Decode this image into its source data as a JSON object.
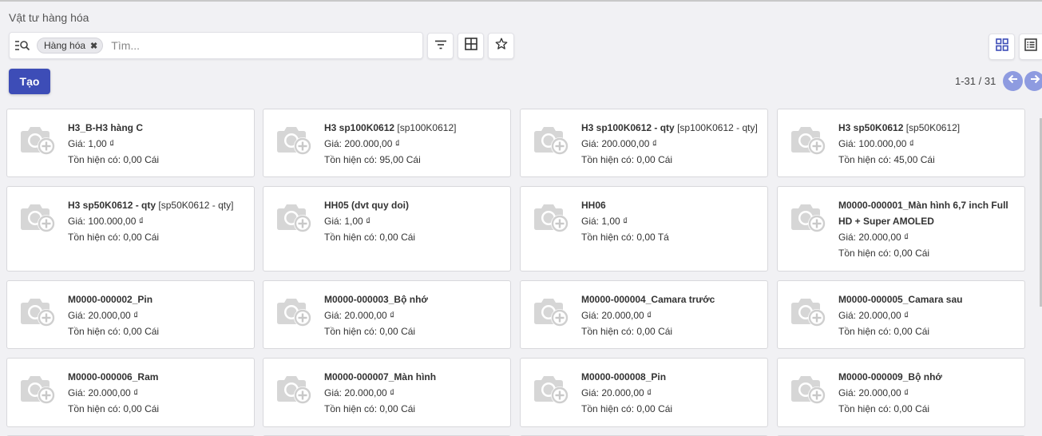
{
  "breadcrumb": "Vật tư hàng hóa",
  "search": {
    "facet_label": "Hàng hóa",
    "placeholder": "Tìm..."
  },
  "toolbar": {
    "create_label": "Tạo"
  },
  "pager": {
    "text": "1-31 / 31"
  },
  "icons": {
    "search": "search-list-icon",
    "filter": "filter-icon",
    "groupby": "grid-icon",
    "favorite": "star-icon",
    "kanban_view": "kanban-view-icon",
    "list_view": "list-view-icon",
    "prev": "arrow-left-icon",
    "next": "arrow-right-icon",
    "product_image": "camera-add-icon"
  },
  "colors": {
    "primary": "#3d4db7",
    "pager": "#8e9be0"
  },
  "products": [
    {
      "name": "H3_B-H3 hàng C",
      "code": "",
      "price": "Giá: 1,00 ₫",
      "stock": "Tồn hiện có: 0,00 Cái"
    },
    {
      "name": "H3 sp100K0612",
      "code": " [sp100K0612]",
      "price": "Giá: 200.000,00 ₫",
      "stock": "Tồn hiện có: 95,00 Cái"
    },
    {
      "name": "H3 sp100K0612 - qty",
      "code": " [sp100K0612 - qty]",
      "price": "Giá: 200.000,00 ₫",
      "stock": "Tồn hiện có: 0,00 Cái"
    },
    {
      "name": "H3 sp50K0612",
      "code": " [sp50K0612]",
      "price": "Giá: 100.000,00 ₫",
      "stock": "Tồn hiện có: 45,00 Cái"
    },
    {
      "name": "H3 sp50K0612 - qty",
      "code": " [sp50K0612 - qty]",
      "price": "Giá: 100.000,00 ₫",
      "stock": "Tồn hiện có: 0,00 Cái"
    },
    {
      "name": "HH05 (dvt quy doi)",
      "code": "",
      "price": "Giá: 1,00 ₫",
      "stock": "Tồn hiện có: 0,00 Cái"
    },
    {
      "name": "HH06",
      "code": "",
      "price": "Giá: 1,00 ₫",
      "stock": "Tồn hiện có: 0,00 Tá"
    },
    {
      "name": "M0000-000001_Màn hình 6,7 inch Full HD + Super AMOLED",
      "code": "",
      "price": "Giá: 20.000,00 ₫",
      "stock": "Tồn hiện có: 0,00 Cái"
    },
    {
      "name": "M0000-000002_Pin",
      "code": "",
      "price": "Giá: 20.000,00 ₫",
      "stock": "Tồn hiện có: 0,00 Cái"
    },
    {
      "name": "M0000-000003_Bộ nhớ",
      "code": "",
      "price": "Giá: 20.000,00 ₫",
      "stock": "Tồn hiện có: 0,00 Cái"
    },
    {
      "name": "M0000-000004_Camara trước",
      "code": "",
      "price": "Giá: 20.000,00 ₫",
      "stock": "Tồn hiện có: 0,00 Cái"
    },
    {
      "name": "M0000-000005_Camara sau",
      "code": "",
      "price": "Giá: 20.000,00 ₫",
      "stock": "Tồn hiện có: 0,00 Cái"
    },
    {
      "name": "M0000-000006_Ram",
      "code": "",
      "price": "Giá: 20.000,00 ₫",
      "stock": "Tồn hiện có: 0,00 Cái"
    },
    {
      "name": "M0000-000007_Màn hình",
      "code": "",
      "price": "Giá: 20.000,00 ₫",
      "stock": "Tồn hiện có: 0,00 Cái"
    },
    {
      "name": "M0000-000008_Pin",
      "code": "",
      "price": "Giá: 20.000,00 ₫",
      "stock": "Tồn hiện có: 0,00 Cái"
    },
    {
      "name": "M0000-000009_Bộ nhớ",
      "code": "",
      "price": "Giá: 20.000,00 ₫",
      "stock": "Tồn hiện có: 0,00 Cái"
    }
  ]
}
